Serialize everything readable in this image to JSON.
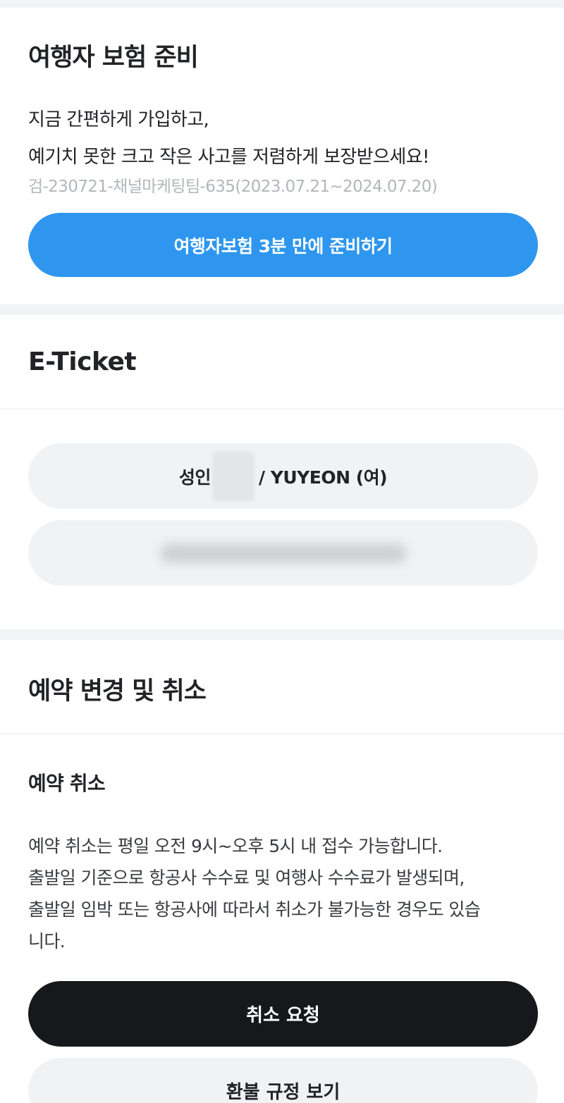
{
  "insurance": {
    "title": "여행자 보험 준비",
    "description_line1": "지금 간편하게 가입하고,",
    "description_line2": "예기치 못한 크고 작은 사고를 저렴하게 보장받으세요!",
    "code": "검-230721-채널마케팅팀-635(2023.07.21~2024.07.20)",
    "button_label": "여행자보험 3분 만에 준비하기",
    "button_color": "#2e96ee"
  },
  "ticket": {
    "title": "E-Ticket",
    "passenger_prefix": "성인",
    "passenger_suffix": "/ YUYEON (여)"
  },
  "reservation": {
    "title": "예약 변경 및 취소",
    "cancel_subtitle": "예약 취소",
    "cancel_desc_line1": "예약 취소는 평일 오전 9시~오후 5시 내 접수 가능합니다.",
    "cancel_desc_line2": "출발일 기준으로 항공사 수수료 및 여행사 수수료가 발생되며,",
    "cancel_desc_line3": "출발일 임박 또는 항공사에 따라서 취소가 불가능한 경우도 있습",
    "cancel_desc_line4": "니다.",
    "cancel_button_label": "취소 요청",
    "refund_button_label": "환불 규정 보기"
  }
}
